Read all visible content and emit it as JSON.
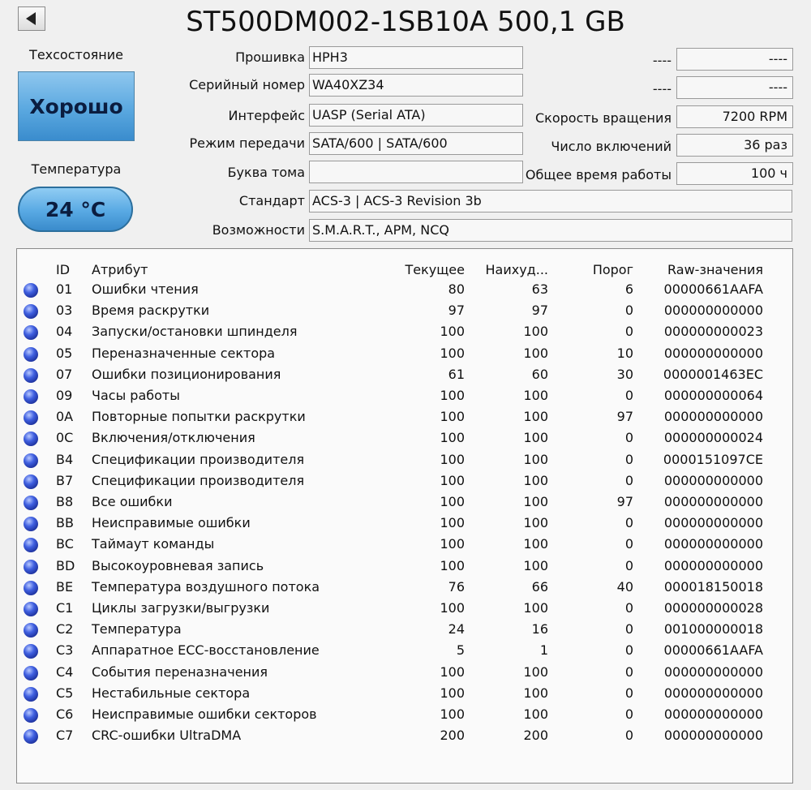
{
  "title": "ST500DM002-1SB10A 500,1 GB",
  "health": {
    "label": "Техсостояние",
    "value": "Хорошо"
  },
  "temperature": {
    "label": "Температура",
    "value": "24 °C"
  },
  "fields_left": [
    {
      "label": "Прошивка",
      "value": "HPH3"
    },
    {
      "label": "Серийный номер",
      "value": "WA40XZ34"
    },
    {
      "label": "Интерфейс",
      "value": "UASP (Serial ATA)"
    },
    {
      "label": "Режим передачи",
      "value": "SATA/600 | SATA/600"
    },
    {
      "label": "Буква тома",
      "value": ""
    }
  ],
  "fields_wide": [
    {
      "label": "Стандарт",
      "value": "ACS-3 | ACS-3 Revision 3b"
    },
    {
      "label": "Возможности",
      "value": "S.M.A.R.T., APM, NCQ"
    }
  ],
  "fields_right": [
    {
      "label": "----",
      "value": "----"
    },
    {
      "label": "----",
      "value": "----"
    },
    {
      "label": "Скорость вращения",
      "value": "7200 RPM"
    },
    {
      "label": "Число включений",
      "value": "36 раз"
    },
    {
      "label": "Общее время работы",
      "value": "100 ч"
    }
  ],
  "table": {
    "headers": {
      "id": "ID",
      "attr": "Атрибут",
      "current": "Текущее",
      "worst": "Наихуд...",
      "threshold": "Порог",
      "raw": "Raw-значения"
    },
    "rows": [
      {
        "id": "01",
        "attr": "Ошибки чтения",
        "current": "80",
        "worst": "63",
        "threshold": "6",
        "raw": "00000661AAFA"
      },
      {
        "id": "03",
        "attr": "Время раскрутки",
        "current": "97",
        "worst": "97",
        "threshold": "0",
        "raw": "000000000000"
      },
      {
        "id": "04",
        "attr": "Запуски/остановки шпинделя",
        "current": "100",
        "worst": "100",
        "threshold": "0",
        "raw": "000000000023"
      },
      {
        "id": "05",
        "attr": "Переназначенные сектора",
        "current": "100",
        "worst": "100",
        "threshold": "10",
        "raw": "000000000000"
      },
      {
        "id": "07",
        "attr": "Ошибки позиционирования",
        "current": "61",
        "worst": "60",
        "threshold": "30",
        "raw": "0000001463EC"
      },
      {
        "id": "09",
        "attr": "Часы работы",
        "current": "100",
        "worst": "100",
        "threshold": "0",
        "raw": "000000000064"
      },
      {
        "id": "0A",
        "attr": "Повторные попытки раскрутки",
        "current": "100",
        "worst": "100",
        "threshold": "97",
        "raw": "000000000000"
      },
      {
        "id": "0C",
        "attr": "Включения/отключения",
        "current": "100",
        "worst": "100",
        "threshold": "0",
        "raw": "000000000024"
      },
      {
        "id": "B4",
        "attr": "Спецификации производителя",
        "current": "100",
        "worst": "100",
        "threshold": "0",
        "raw": "0000151097CE"
      },
      {
        "id": "B7",
        "attr": "Спецификации производителя",
        "current": "100",
        "worst": "100",
        "threshold": "0",
        "raw": "000000000000"
      },
      {
        "id": "B8",
        "attr": "Все ошибки",
        "current": "100",
        "worst": "100",
        "threshold": "97",
        "raw": "000000000000"
      },
      {
        "id": "BB",
        "attr": "Неисправимые ошибки",
        "current": "100",
        "worst": "100",
        "threshold": "0",
        "raw": "000000000000"
      },
      {
        "id": "BC",
        "attr": "Таймаут команды",
        "current": "100",
        "worst": "100",
        "threshold": "0",
        "raw": "000000000000"
      },
      {
        "id": "BD",
        "attr": "Высокоуровневая запись",
        "current": "100",
        "worst": "100",
        "threshold": "0",
        "raw": "000000000000"
      },
      {
        "id": "BE",
        "attr": "Температура воздушного потока",
        "current": "76",
        "worst": "66",
        "threshold": "40",
        "raw": "000018150018"
      },
      {
        "id": "C1",
        "attr": "Циклы загрузки/выгрузки",
        "current": "100",
        "worst": "100",
        "threshold": "0",
        "raw": "000000000028"
      },
      {
        "id": "C2",
        "attr": "Температура",
        "current": "24",
        "worst": "16",
        "threshold": "0",
        "raw": "001000000018"
      },
      {
        "id": "C3",
        "attr": "Аппаратное ECC-восстановление",
        "current": "5",
        "worst": "1",
        "threshold": "0",
        "raw": "00000661AAFA"
      },
      {
        "id": "C4",
        "attr": "События переназначения",
        "current": "100",
        "worst": "100",
        "threshold": "0",
        "raw": "000000000000"
      },
      {
        "id": "C5",
        "attr": "Нестабильные сектора",
        "current": "100",
        "worst": "100",
        "threshold": "0",
        "raw": "000000000000"
      },
      {
        "id": "C6",
        "attr": "Неисправимые ошибки секторов",
        "current": "100",
        "worst": "100",
        "threshold": "0",
        "raw": "000000000000"
      },
      {
        "id": "C7",
        "attr": "CRC-ошибки UltraDMA",
        "current": "200",
        "worst": "200",
        "threshold": "0",
        "raw": "000000000000"
      }
    ]
  }
}
